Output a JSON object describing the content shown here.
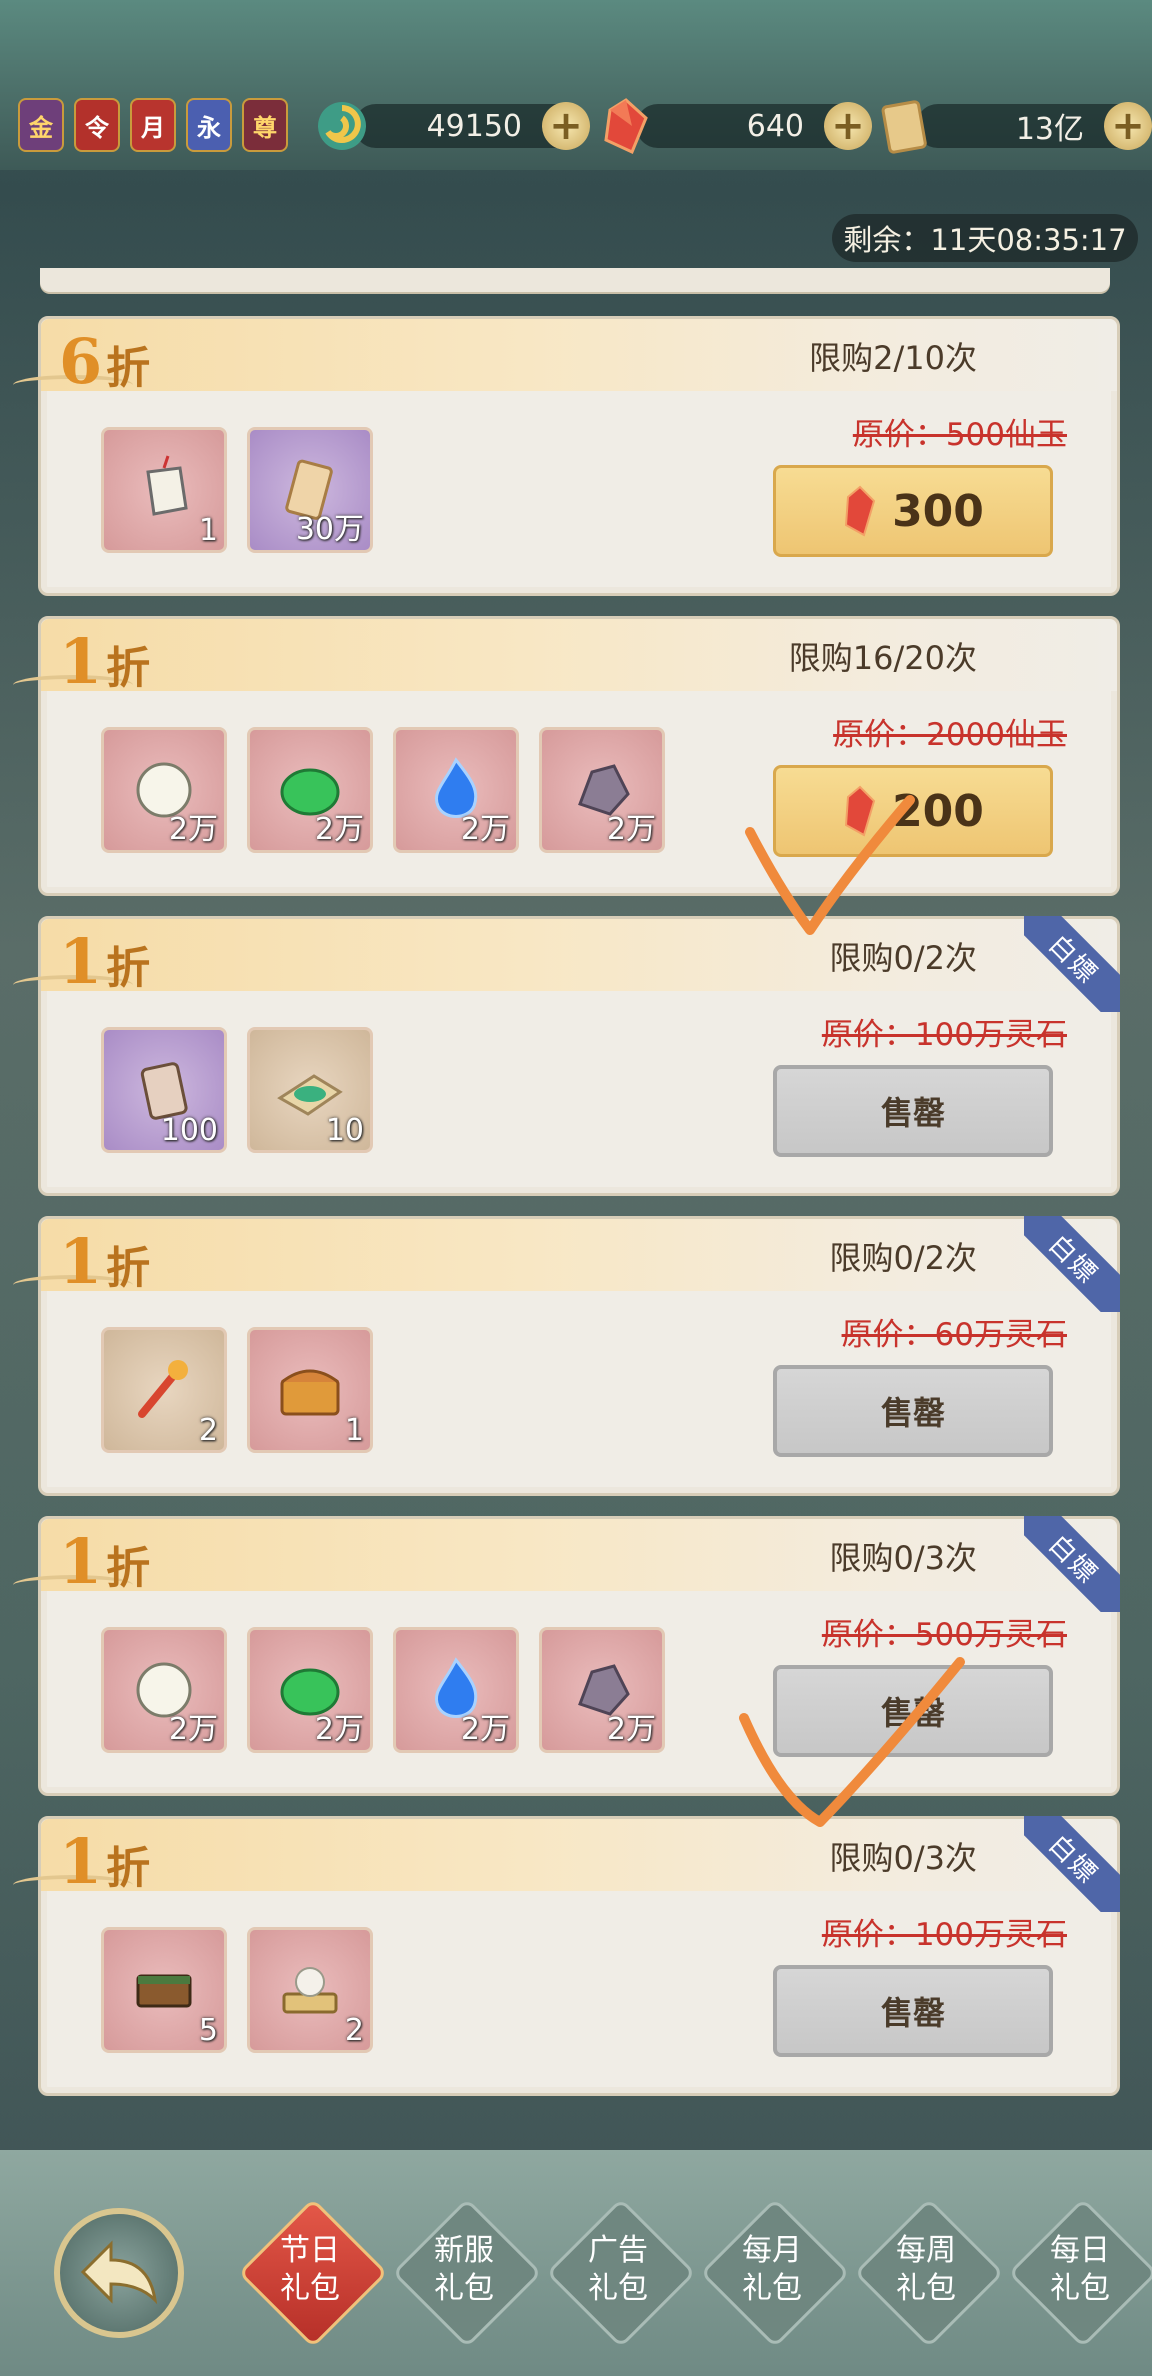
{
  "badges": [
    "金",
    "令",
    "月",
    "永",
    "尊"
  ],
  "currencies": [
    {
      "icon": "spiral-jade-icon",
      "value": "49150"
    },
    {
      "icon": "red-gem-icon",
      "value": "640"
    },
    {
      "icon": "scroll-icon",
      "value": "13亿"
    }
  ],
  "timer": "剩余：11天08:35:17",
  "zhe": "折",
  "sold_label": "售罄",
  "corner_label": "白嫖",
  "cards": [
    {
      "discount": "6",
      "limit": "限购2/10次",
      "orig": "原价：500仙玉",
      "price": "300",
      "items": [
        {
          "icon": "talisman-icon",
          "qty": "1",
          "bg": "red"
        },
        {
          "icon": "paper-scroll-icon",
          "qty": "30万",
          "bg": "purple"
        }
      ]
    },
    {
      "discount": "1",
      "limit": "限购16/20次",
      "orig": "原价：2000仙玉",
      "price": "200",
      "items": [
        {
          "icon": "pearl-icon",
          "qty": "2万",
          "bg": "red"
        },
        {
          "icon": "green-herb-icon",
          "qty": "2万",
          "bg": "red"
        },
        {
          "icon": "blue-flame-icon",
          "qty": "2万",
          "bg": "red"
        },
        {
          "icon": "ore-stone-icon",
          "qty": "2万",
          "bg": "red"
        }
      ]
    },
    {
      "discount": "1",
      "limit": "限购0/2次",
      "orig": "原价：100万灵石",
      "price": "",
      "items": [
        {
          "icon": "token-plaque-icon",
          "qty": "100",
          "bg": "purple"
        },
        {
          "icon": "jade-map-icon",
          "qty": "10",
          "bg": "tan"
        }
      ]
    },
    {
      "discount": "1",
      "limit": "限购0/2次",
      "orig": "原价：60万灵石",
      "price": "",
      "items": [
        {
          "icon": "phoenix-key-icon",
          "qty": "2",
          "bg": "tan"
        },
        {
          "icon": "treasure-chest-icon",
          "qty": "1",
          "bg": "red"
        }
      ]
    },
    {
      "discount": "1",
      "limit": "限购0/3次",
      "orig": "原价：500万灵石",
      "price": "",
      "items": [
        {
          "icon": "pearl-icon",
          "qty": "2万",
          "bg": "red"
        },
        {
          "icon": "green-herb-icon",
          "qty": "2万",
          "bg": "red"
        },
        {
          "icon": "blue-flame-icon",
          "qty": "2万",
          "bg": "red"
        },
        {
          "icon": "ore-stone-icon",
          "qty": "2万",
          "bg": "red"
        }
      ]
    },
    {
      "discount": "1",
      "limit": "限购0/3次",
      "orig": "原价：100万灵石",
      "price": "",
      "items": [
        {
          "icon": "wooden-box-icon",
          "qty": "5",
          "bg": "red"
        },
        {
          "icon": "lotus-bed-icon",
          "qty": "2",
          "bg": "red"
        }
      ]
    }
  ],
  "tabs": [
    {
      "l1": "节日",
      "l2": "礼包"
    },
    {
      "l1": "新服",
      "l2": "礼包"
    },
    {
      "l1": "广告",
      "l2": "礼包"
    },
    {
      "l1": "每月",
      "l2": "礼包"
    },
    {
      "l1": "每周",
      "l2": "礼包"
    },
    {
      "l1": "每日",
      "l2": "礼包"
    }
  ],
  "colors": {
    "discount": "#e08f27",
    "strike": "#c8332c",
    "buy": "#eec572",
    "check": "#f08a3c",
    "corner": "#4f66a8"
  }
}
